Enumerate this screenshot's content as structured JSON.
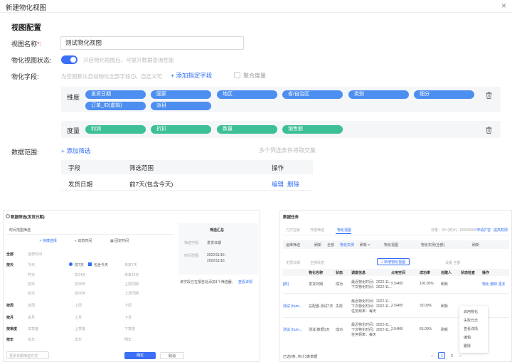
{
  "header": {
    "title": "新建物化视图",
    "close_glyph": "×"
  },
  "section_title": "视图配置",
  "form": {
    "name_label": "视图名称",
    "name_req": "*",
    "name_colon": ":",
    "name_value": "测试物化视图",
    "status_label": "物化视图状态:",
    "status_hint": "开启物化视图后，可提升数据查询性能",
    "fields_label": "物化字段:",
    "fields_hint": "为空则默认自动物化全部字段",
    "fields_hint2": "，自定义可",
    "add_fields_link": "+ 添加指定字段",
    "aggregate_label": "聚合度量",
    "dimension_label": "维度",
    "dimensions": [
      "发货日期",
      "国家",
      "地区",
      "省/自治区",
      "类别",
      "细分",
      "订单_ID(虚拟)",
      "派目"
    ],
    "measure_label": "度量",
    "measures": [
      "利润",
      "折扣",
      "数量",
      "销售额"
    ],
    "range_label": "数据范围:",
    "add_filter_link": "+ 添加筛选",
    "range_hint": "多个筛选条件将取交集",
    "table": {
      "headers": [
        "字段",
        "筛选范围",
        "操作"
      ],
      "rows": [
        {
          "field": "发货日期",
          "range": "前7天(包含今天)",
          "edit": "编辑",
          "delete": "删除"
        }
      ]
    }
  },
  "left_shot": {
    "title": "数据筛选(发货日期)",
    "tab": "时间范围筛选",
    "modes": [
      "快捷选择",
      "动态时间",
      "固定时间"
    ],
    "summary_title": "筛选汇总",
    "summary_k1": "筛选字段:",
    "summary_v1": "发货日期",
    "summary_k2": "时间范围:",
    "summary_v2a": "2022/11/16 -",
    "summary_v2b": "2022/11/16",
    "note": "该字段已在报告处添加1个筛选器,",
    "note_link": "查看详情",
    "rows": [
      {
        "h": "全部",
        "c": [
          "全部时间"
        ]
      },
      {
        "h": "按天",
        "c": [
          "今天",
          "前7天",
          "包含今天",
          "未来7天"
        ]
      },
      {
        "h": "",
        "c": [
          "昨天",
          "前14天",
          "",
          "未来14天"
        ]
      },
      {
        "h": "",
        "c": [
          "前天",
          "前30天",
          "",
          "上周同期"
        ]
      },
      {
        "h": "",
        "c": [
          "后天",
          "前90天",
          "",
          "上月同期"
        ]
      },
      {
        "h": "按周",
        "c": [
          "本周",
          "上周",
          "下周"
        ]
      },
      {
        "h": "按月",
        "c": [
          "本月",
          "上月",
          "下月"
        ]
      },
      {
        "h": "按季度",
        "c": [
          "本季度",
          "上季度",
          "下季度"
        ]
      },
      {
        "h": "按年",
        "c": [
          "本年",
          "去年",
          "明年"
        ]
      }
    ],
    "bottom_select": "更多日期筛选方式",
    "confirm": "确定",
    "cancel": "取消"
  },
  "right_shot": {
    "title": "数据任务",
    "tabs": [
      "刀刃在解",
      "开窗筛选",
      "物化视图"
    ],
    "top_info": "存量：0/0  (统计) ·1000/0000",
    "top_links": [
      "申请扩容",
      "提高权限"
    ],
    "toolbar": [
      "运维筛选",
      "刷新",
      "全部",
      "筛选",
      "物化实例",
      "刷新 ×",
      "物化视图",
      "物化实例(全部)",
      "刷新"
    ],
    "new_button": "+ 新增物化视图",
    "sub_filters": [
      "无限日期",
      "全部状态"
    ],
    "sub_right": "设置 全部",
    "headers": [
      "物化名称",
      "状态",
      "调度信息",
      "占用空间",
      "成功率",
      "创建人",
      "状态检查",
      "操作"
    ],
    "rows": [
      {
        "name": "[新]",
        "src": "发货日期",
        "status": "成功",
        "info": [
          "最近物化时间：2022-11...",
          "下次物化时间：2022-11..."
        ],
        "size": "2.54KB",
        "rate": "100.00%",
        "user": "刷新",
        "op": "物化 删除 更多"
      },
      {
        "name": "测试 (hum...",
        "src": "总配置-测试7天",
        "status": "失败",
        "info": [
          "最近物化时间：2022-11...",
          "下次物化时间：2022-11...",
          "任务频率：每天"
        ],
        "size": "2.54KB",
        "rate": "33.00%",
        "user": "刷新",
        "op": ""
      },
      {
        "name": "测试 (hum...",
        "src": "测试-数据1天",
        "status": "成功",
        "info": [
          "最近物化时间：2022-11...",
          "下次物化时间：2022-11...",
          "任务频率：每天"
        ],
        "size": "2.54KB",
        "rate": "66.00%",
        "user": "刷新",
        "op": ""
      }
    ],
    "menu": [
      "启用物化",
      "失败日志",
      "查看详情",
      "编辑",
      "删除"
    ],
    "footer_left": "已选0条, 共计3条数据",
    "pages": [
      "<",
      "1",
      "2",
      ">"
    ]
  }
}
